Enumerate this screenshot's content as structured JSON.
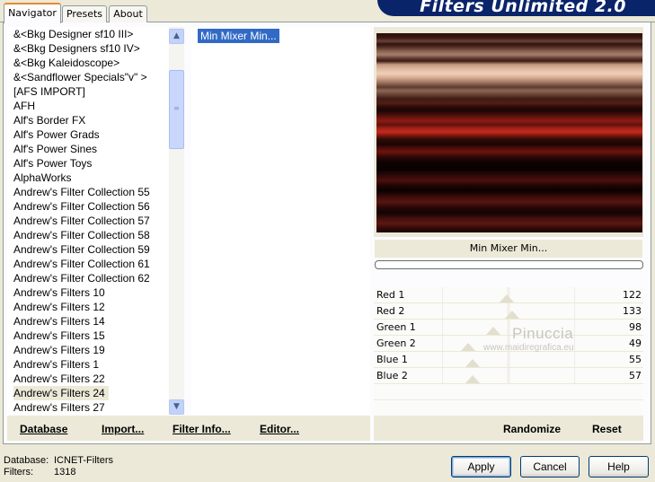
{
  "tabs": [
    {
      "label": "Navigator",
      "active": true
    },
    {
      "label": "Presets",
      "active": false
    },
    {
      "label": "About",
      "active": false
    }
  ],
  "banner": {
    "title": "Filters Unlimited 2.0"
  },
  "categories": [
    "&<Bkg Designer sf10 III>",
    "&<Bkg Designers sf10 IV>",
    "&<Bkg Kaleidoscope>",
    "&<Sandflower Specials\"v\" >",
    "[AFS IMPORT]",
    "AFH",
    "Alf's Border FX",
    "Alf's Power Grads",
    "Alf's Power Sines",
    "Alf's Power Toys",
    "AlphaWorks",
    "Andrew's Filter Collection 55",
    "Andrew's Filter Collection 56",
    "Andrew's Filter Collection 57",
    "Andrew's Filter Collection 58",
    "Andrew's Filter Collection 59",
    "Andrew's Filter Collection 61",
    "Andrew's Filter Collection 62",
    "Andrew's Filters 10",
    "Andrew's Filters 12",
    "Andrew's Filters 14",
    "Andrew's Filters 15",
    "Andrew's Filters 19",
    "Andrew's Filters 1",
    "Andrew's Filters 22",
    "Andrew's Filters 24",
    "Andrew's Filters 27"
  ],
  "selected_category_index": 25,
  "filters": [
    "Min Mixer Min..."
  ],
  "preview": {
    "effect_name": "Min Mixer Min..."
  },
  "params": [
    {
      "name": "Red 1",
      "value": "122",
      "level": 0.48
    },
    {
      "name": "Red 2",
      "value": "133",
      "level": 0.52
    },
    {
      "name": "Green 1",
      "value": "98",
      "level": 0.38
    },
    {
      "name": "Green 2",
      "value": "49",
      "level": 0.19
    },
    {
      "name": "Blue 1",
      "value": "55",
      "level": 0.22
    },
    {
      "name": "Blue 2",
      "value": "57",
      "level": 0.22
    }
  ],
  "watermark": {
    "name": "Pinuccia",
    "site": "www.maidiregrafica.eu"
  },
  "toolbar": {
    "database": "Database",
    "import": "Import...",
    "filter_info": "Filter Info...",
    "editor": "Editor...",
    "randomize": "Randomize",
    "reset": "Reset"
  },
  "status": {
    "database_label": "Database:",
    "database_value": "ICNET-Filters",
    "filters_label": "Filters:",
    "filters_value": "1318"
  },
  "buttons": {
    "apply": "Apply",
    "cancel": "Cancel",
    "help": "Help"
  }
}
